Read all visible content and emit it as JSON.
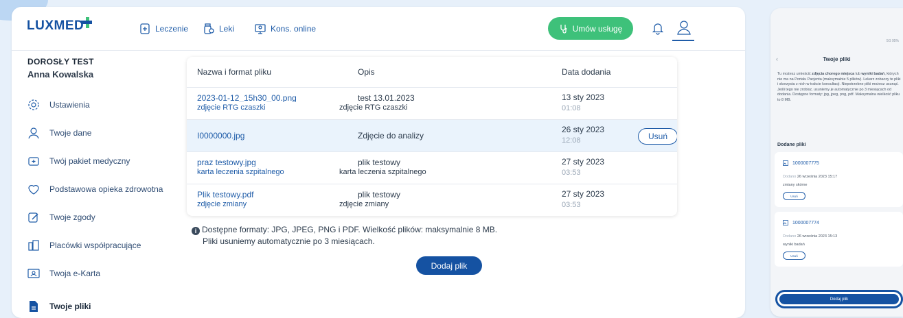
{
  "header": {
    "logo": "LUXMED",
    "nav": [
      {
        "label": "Leczenie",
        "icon": "medical-case-icon"
      },
      {
        "label": "Leki",
        "icon": "pills-icon"
      },
      {
        "label": "Kons. online",
        "icon": "video-consult-icon"
      }
    ],
    "cta_label": "Umów usługę",
    "colors": {
      "brand": "#1552a2",
      "cta": "#3ec17a",
      "link": "#1f5ca8"
    }
  },
  "sidebar": {
    "account_type": "DOROSŁY TEST",
    "user_name": "Anna Kowalska",
    "items": [
      {
        "label": "Ustawienia",
        "icon": "settings-icon"
      },
      {
        "label": "Twoje dane",
        "icon": "user-icon"
      },
      {
        "label": "Twój pakiet medyczny",
        "icon": "medical-package-icon"
      },
      {
        "label": "Podstawowa opieka zdrowotna",
        "icon": "heart-icon"
      },
      {
        "label": "Twoje zgody",
        "icon": "edit-icon"
      },
      {
        "label": "Placówki współpracujące",
        "icon": "buildings-icon"
      },
      {
        "label": "Twoja e-Karta",
        "icon": "id-card-icon"
      },
      {
        "label": "Twoje pliki",
        "icon": "file-icon",
        "active": true
      }
    ]
  },
  "files_table": {
    "headers": [
      "Nazwa i format pliku",
      "Opis",
      "Data dodania"
    ],
    "rows": [
      {
        "file": "2023-01-12_15h30_00.png",
        "description": "test 13.01.2023",
        "date": "13 sty 2023",
        "time": "01:08",
        "overlay_file": "zdjęcie RTG czaszki",
        "overlay_desc": "zdjęcie RTG czaszki"
      },
      {
        "file": "I0000000.jpg",
        "description": "Zdjęcie do analizy",
        "date": "26 sty 2023",
        "time": "12:08",
        "remove_label": "Usuń"
      },
      {
        "file": "praz testowy.jpg",
        "description": "plik testowy",
        "date": "27 sty 2023",
        "time": "03:53",
        "overlay_file": "karta leczenia szpitalnego",
        "overlay_desc": "karta leczenia szpitalnego"
      },
      {
        "file": "Plik testowy.pdf",
        "description": "plik testowy",
        "date": "27 sty 2023",
        "time": "03:53",
        "overlay_file": "zdjęcie zmiany",
        "overlay_desc": "zdjęcie zmiany"
      }
    ]
  },
  "info": {
    "line1": "Dostępne formaty: JPG, JPEG, PNG i PDF. Wielkość plików: maksymalnie 8 MB.",
    "line2": "Pliki usuniemy automatycznie po 3 miesiącach."
  },
  "add_file_label": "Dodaj plik",
  "mobile": {
    "status": "5G 95%",
    "back": "‹",
    "title": "Twoje pliki",
    "desc_pre": "Tu możesz umieścić ",
    "desc_bold1": "zdjęcia chorego miejsca",
    "desc_mid": " lub ",
    "desc_bold2": "wyniki badań",
    "desc_post": ", których nie ma na Portalu Pacjenta (maksymalnie 5 plików). Lekarz zobaczy te pliki i skorzysta z nich w trakcie konsultacji. Niepotrzebne pliki możesz usunąć. Jeśli tego nie zrobisz, usuniemy je automatycznie po 3 miesiącach od dodania. Dostępne formaty: jpg, jpeg, png, pdf. Maksymalna wielkość pliku to 8 MB.",
    "section": "Dodane pliki",
    "files": [
      {
        "name": "1000007775",
        "date_prefix": "Dodano",
        "date": "26 września 2023 15:17",
        "desc": "zmiany skórne",
        "remove": "Usuń"
      },
      {
        "name": "1000007774",
        "date_prefix": "Dodano",
        "date": "26 września 2023 15:13",
        "desc": "wyniki badań",
        "remove": "Usuń"
      }
    ],
    "add_label": "Dodaj plik"
  }
}
